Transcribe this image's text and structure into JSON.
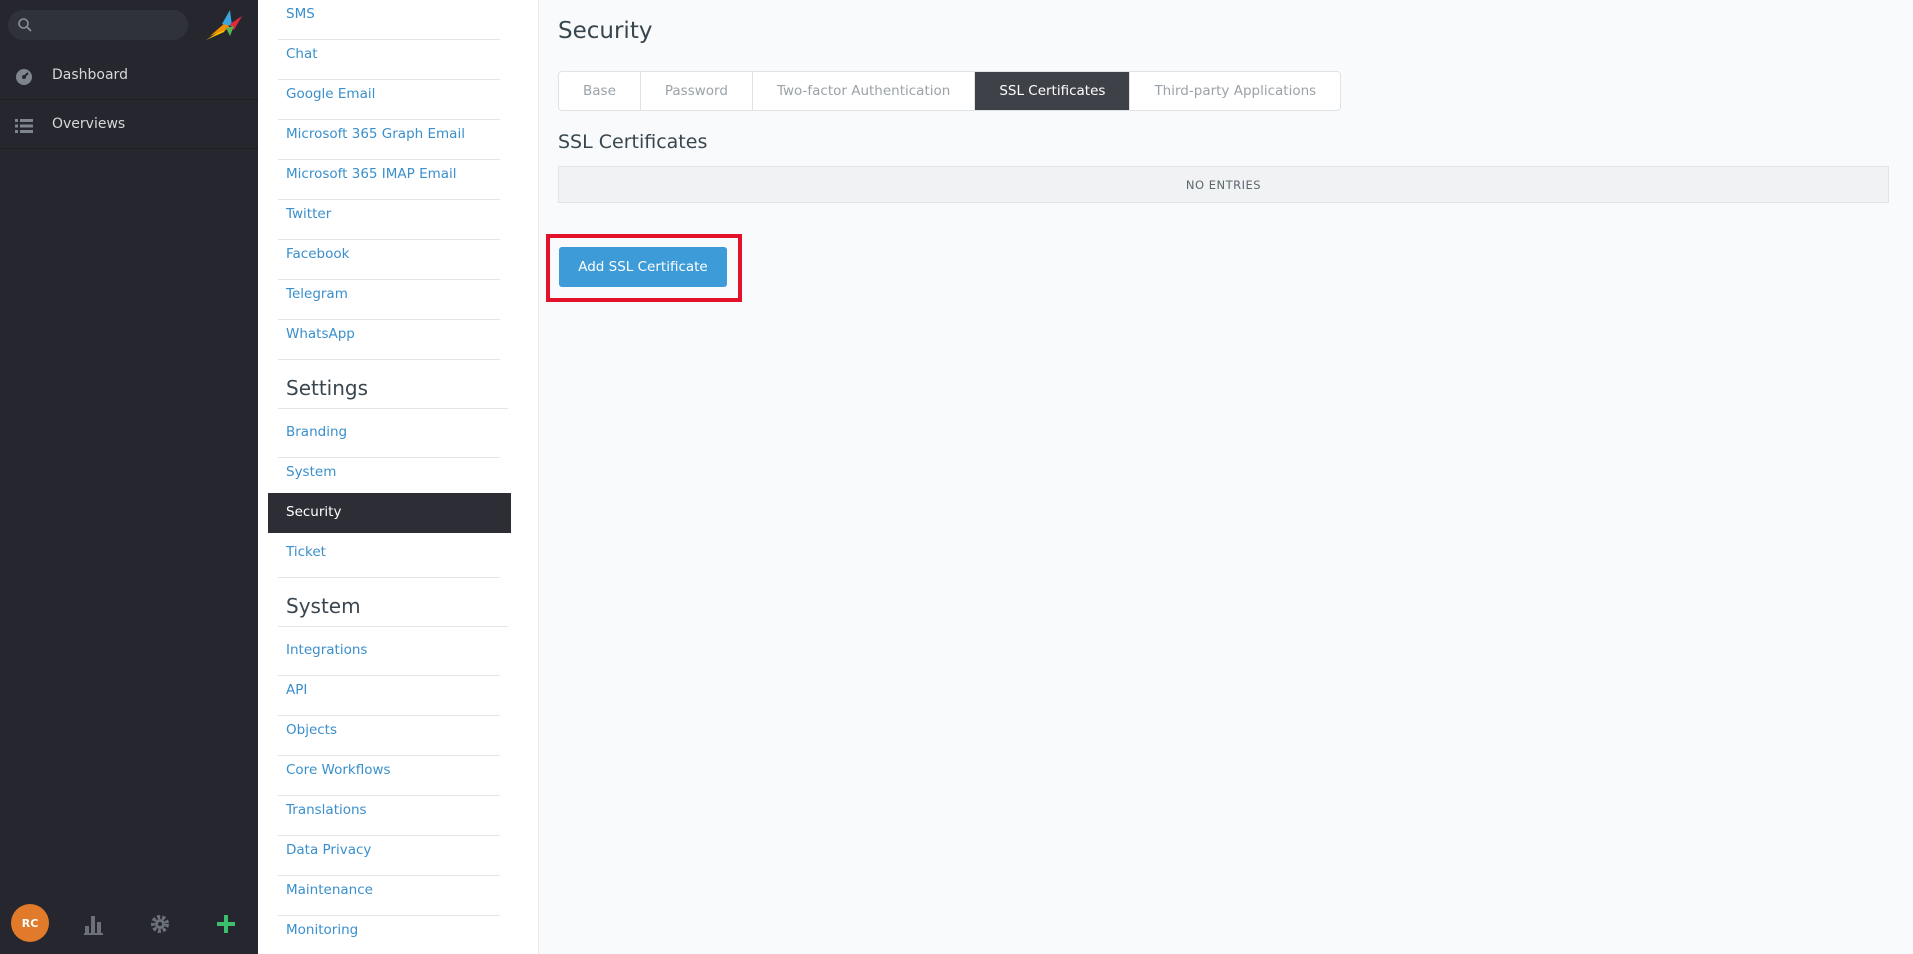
{
  "search": {
    "placeholder": ""
  },
  "nav": {
    "items": [
      {
        "label": "Dashboard",
        "icon": "dashboard-icon"
      },
      {
        "label": "Overviews",
        "icon": "list-icon"
      }
    ],
    "avatar_initials": "RC"
  },
  "menu": {
    "channels": [
      "SMS",
      "Chat",
      "Google Email",
      "Microsoft 365 Graph Email",
      "Microsoft 365 IMAP Email",
      "Twitter",
      "Facebook",
      "Telegram",
      "WhatsApp"
    ],
    "settings_heading": "Settings",
    "settings": [
      "Branding",
      "System",
      "Security",
      "Ticket"
    ],
    "system_heading": "System",
    "system": [
      "Integrations",
      "API",
      "Objects",
      "Core Workflows",
      "Translations",
      "Data Privacy",
      "Maintenance",
      "Monitoring"
    ]
  },
  "content": {
    "title": "Security",
    "tabs": [
      "Base",
      "Password",
      "Two-factor Authentication",
      "SSL Certificates",
      "Third-party Applications"
    ],
    "active_tab": "SSL Certificates",
    "section_title": "SSL Certificates",
    "empty_text": "NO ENTRIES",
    "add_button": "Add SSL Certificate"
  },
  "colors": {
    "nav_bg": "#26272e",
    "active_item_bg": "#2d2e35",
    "link": "#3a8fcc",
    "primary_button": "#3d9bd8",
    "highlight": "#e3122a",
    "avatar": "#e17a2a",
    "plus": "#3dbe6e"
  }
}
